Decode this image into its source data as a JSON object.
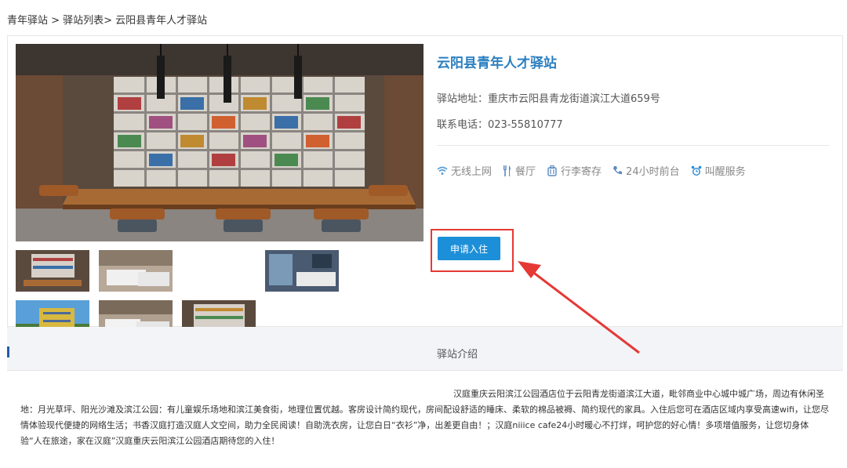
{
  "breadcrumb": {
    "text": "青年驿站 > 驿站列表> 云阳县青年人才驿站"
  },
  "station": {
    "title": "云阳县青年人才驿站",
    "address": "驿站地址：重庆市云阳县青龙街道滨江大道659号",
    "phone": "联系电话：023-55810777"
  },
  "amenities": [
    {
      "label": "无线上网",
      "icon": "wifi-icon"
    },
    {
      "label": "餐厅",
      "icon": "restaurant-icon"
    },
    {
      "label": "行李寄存",
      "icon": "luggage-icon"
    },
    {
      "label": "24小时前台",
      "icon": "phone-icon"
    },
    {
      "label": "叫醒服务",
      "icon": "alarm-clock-icon"
    }
  ],
  "apply_button": {
    "label": "申请入住"
  },
  "intro": {
    "title": "驿站介绍",
    "text": "汉庭重庆云阳滨江公园酒店位于云阳青龙街道滨江大道，毗邻商业中心城中城广场，周边有休闲圣地：月光草坪、阳光沙滩及滨江公园：有儿童娱乐场地和滨江美食街，地理位置优越。客房设计简约现代，房间配设舒适的睡床、柔软的棉品被褥、简约现代的家具。入住后您可在酒店区域内享受高速wifi，让您尽情体验现代便捷的网络生活；书香汉庭打造汉庭人文空间，助力全民阅读！自助洗衣房，让您白日“衣衫”净，出差更自由！；汉庭niiice cafe24小时暖心不打烊，呵护您的好心情！多项增值服务，让您切身体验“人在旅途，家在汉庭”汉庭重庆云阳滨江公园酒店期待您的入住！"
  },
  "colors": {
    "accent": "#2a7fc1",
    "button": "#1d8fd8",
    "highlight": "#e53935"
  }
}
